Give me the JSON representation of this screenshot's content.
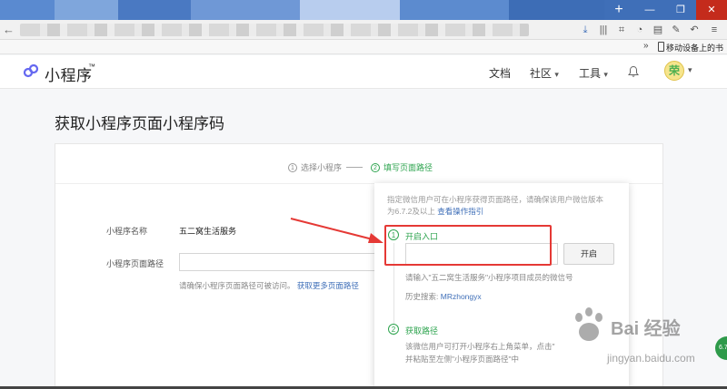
{
  "site": {
    "logo_text": "小程序",
    "logo_tm": "™",
    "nav": {
      "docs": "文档",
      "community": "社区",
      "tools": "工具"
    },
    "avatar_text": "荣"
  },
  "browser": {
    "bookmark_mobile": "移动设备上的书"
  },
  "page": {
    "title": "获取小程序页面小程序码",
    "steps": [
      {
        "num": "1",
        "label": "选择小程序"
      },
      {
        "num": "2",
        "label": "填写页面路径"
      }
    ],
    "form": {
      "name_label": "小程序名称",
      "name_value": "五二窝生活服务",
      "path_label": "小程序页面路径",
      "path_value": "",
      "hint_text": "请确保小程序页面路径可被访问。",
      "hint_link": "获取更多页面路径"
    }
  },
  "popover": {
    "desc_line1": "指定微信用户可在小程序获得页面路径，请确保该用户微信版本",
    "desc_line2": "为6.7.2及以上",
    "desc_link": "查看操作指引",
    "step1": {
      "num": "1",
      "title": "开启入口",
      "input_value": "",
      "button": "开启",
      "hint": "请输入\"五二窝生活服务\"小程序项目成员的微信号",
      "history_label": "历史搜索:",
      "history_value": "MRzhongyx"
    },
    "step2": {
      "num": "2",
      "title": "获取路径",
      "line1": "该微信用户可打开小程序右上角菜单，点击\"",
      "line2": "并粘贴至左侧\"小程序页面路径\"中"
    }
  },
  "watermark": {
    "main": "Bai 经验",
    "sub": "jingyan.baidu.com"
  },
  "colors": {
    "accent_green": "#2ea44f",
    "link_blue": "#3f6fb8",
    "annotation_red": "#e53935"
  }
}
